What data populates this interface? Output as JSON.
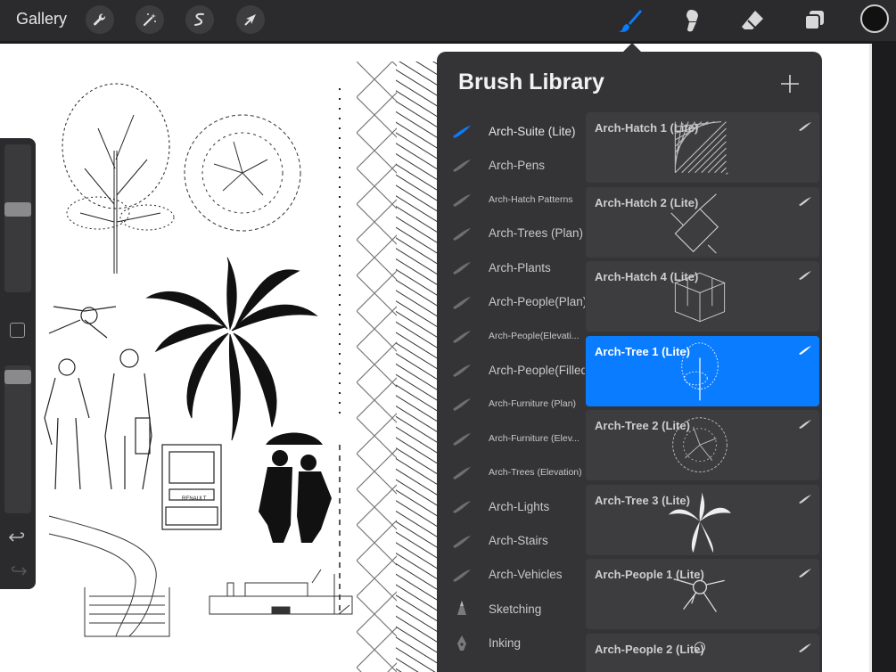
{
  "topbar": {
    "gallery_label": "Gallery",
    "left_tools": [
      "wrench-icon",
      "magic-wand-icon",
      "selection-icon",
      "transform-arrow-icon"
    ],
    "right_tools": [
      "brush-icon",
      "smudge-icon",
      "eraser-icon",
      "layers-icon"
    ],
    "active_tool": "brush-icon",
    "current_color": "#111111"
  },
  "colors": {
    "accent": "#0a7cff",
    "panel": "#343436",
    "card": "#3d3d40",
    "bar": "#2b2b2d"
  },
  "sidebar": {
    "brush_size_level": 0.57,
    "opacity_level": 0.97
  },
  "brush_library": {
    "title": "Brush Library",
    "add_icon": "plus-icon",
    "sets": [
      {
        "label": "Arch-Suite (Lite)",
        "active": true
      },
      {
        "label": "Arch-Pens"
      },
      {
        "label": "Arch-Hatch Patterns",
        "small": true
      },
      {
        "label": "Arch-Trees (Plan)"
      },
      {
        "label": "Arch-Plants"
      },
      {
        "label": "Arch-People(Plan)"
      },
      {
        "label": "Arch-People(Elevati...",
        "small": true
      },
      {
        "label": "Arch-People(Filled)"
      },
      {
        "label": "Arch-Furniture (Plan)",
        "small": true
      },
      {
        "label": "Arch-Furniture (Elev...",
        "small": true
      },
      {
        "label": "Arch-Trees (Elevation)",
        "small": true
      },
      {
        "label": "Arch-Lights"
      },
      {
        "label": "Arch-Stairs"
      },
      {
        "label": "Arch-Vehicles"
      },
      {
        "label": "Sketching",
        "icon": "pencil-tip-icon"
      },
      {
        "label": "Inking",
        "icon": "ink-nib-icon"
      }
    ],
    "brushes": [
      {
        "name": "Arch-Hatch 1 (Lite)",
        "preview": "hatch-preview"
      },
      {
        "name": "Arch-Hatch 2 (Lite)",
        "preview": "hatch-grid-preview"
      },
      {
        "name": "Arch-Hatch 4 (Lite)",
        "preview": "hatch-box-preview"
      },
      {
        "name": "Arch-Tree 1 (Lite)",
        "preview": "tree-elevation-preview",
        "selected": true
      },
      {
        "name": "Arch-Tree 2 (Lite)",
        "preview": "tree-plan-preview"
      },
      {
        "name": "Arch-Tree 3 (Lite)",
        "preview": "palm-preview"
      },
      {
        "name": "Arch-People 1 (Lite)",
        "preview": "person-plan-preview"
      },
      {
        "name": "Arch-People 2 (Lite)",
        "preview": "person-preview"
      }
    ]
  },
  "canvas": {
    "truck_badge": "RENAULT"
  }
}
